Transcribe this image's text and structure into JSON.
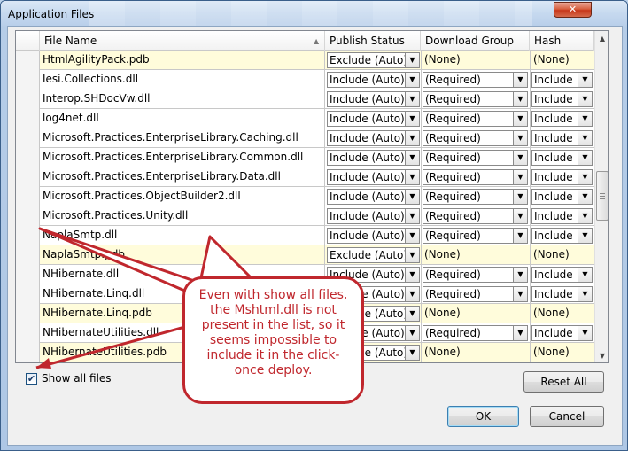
{
  "window": {
    "title": "Application Files",
    "close_label": "✕"
  },
  "columns": {
    "file_name": "File Name",
    "publish_status": "Publish Status",
    "download_group": "Download Group",
    "hash": "Hash"
  },
  "rows": [
    {
      "file": "HtmlAgilityPack.pdb",
      "status": "Exclude (Auto)",
      "group": "(None)",
      "hash": "(None)",
      "pdb": true
    },
    {
      "file": "Iesi.Collections.dll",
      "status": "Include (Auto)",
      "group": "(Required)",
      "hash": "Include",
      "pdb": false
    },
    {
      "file": "Interop.SHDocVw.dll",
      "status": "Include (Auto)",
      "group": "(Required)",
      "hash": "Include",
      "pdb": false
    },
    {
      "file": "log4net.dll",
      "status": "Include (Auto)",
      "group": "(Required)",
      "hash": "Include",
      "pdb": false
    },
    {
      "file": "Microsoft.Practices.EnterpriseLibrary.Caching.dll",
      "status": "Include (Auto)",
      "group": "(Required)",
      "hash": "Include",
      "pdb": false
    },
    {
      "file": "Microsoft.Practices.EnterpriseLibrary.Common.dll",
      "status": "Include (Auto)",
      "group": "(Required)",
      "hash": "Include",
      "pdb": false
    },
    {
      "file": "Microsoft.Practices.EnterpriseLibrary.Data.dll",
      "status": "Include (Auto)",
      "group": "(Required)",
      "hash": "Include",
      "pdb": false
    },
    {
      "file": "Microsoft.Practices.ObjectBuilder2.dll",
      "status": "Include (Auto)",
      "group": "(Required)",
      "hash": "Include",
      "pdb": false
    },
    {
      "file": "Microsoft.Practices.Unity.dll",
      "status": "Include (Auto)",
      "group": "(Required)",
      "hash": "Include",
      "pdb": false
    },
    {
      "file": "NaplaSmtp.dll",
      "status": "Include (Auto)",
      "group": "(Required)",
      "hash": "Include",
      "pdb": false
    },
    {
      "file": "NaplaSmtp.pdb",
      "status": "Exclude (Auto)",
      "group": "(None)",
      "hash": "(None)",
      "pdb": true
    },
    {
      "file": "NHibernate.dll",
      "status": "Include (Auto)",
      "group": "(Required)",
      "hash": "Include",
      "pdb": false
    },
    {
      "file": "NHibernate.Linq.dll",
      "status": "Include (Auto)",
      "group": "(Required)",
      "hash": "Include",
      "pdb": false
    },
    {
      "file": "NHibernate.Linq.pdb",
      "status": "Exclude (Auto)",
      "group": "(None)",
      "hash": "(None)",
      "pdb": true
    },
    {
      "file": "NHibernateUtilities.dll",
      "status": "Include (Auto)",
      "group": "(Required)",
      "hash": "Include",
      "pdb": false
    },
    {
      "file": "NHibernateUtilities.pdb",
      "status": "Exclude (Auto)",
      "group": "(None)",
      "hash": "(None)",
      "pdb": true
    }
  ],
  "show_all_files": {
    "label": "Show all files",
    "checked": true
  },
  "buttons": {
    "reset_all": "Reset All",
    "ok": "OK",
    "cancel": "Cancel"
  },
  "callout": {
    "text": "Even with show all files, the Mshtml.dll is not present in the list, so it seems impossible to include it in the click-once deploy."
  },
  "colors": {
    "annotation": "#c0272d",
    "pdb_row": "#fffcdb"
  }
}
